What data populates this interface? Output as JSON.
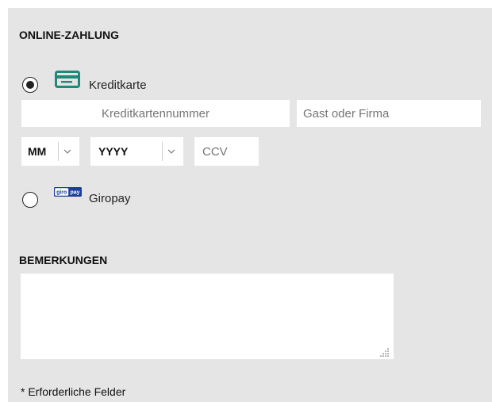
{
  "online_payment": {
    "title": "ONLINE-ZAHLUNG",
    "options": [
      {
        "label": "Kreditkarte",
        "selected": true,
        "icon": "credit-card-icon"
      },
      {
        "label": "Giropay",
        "selected": false,
        "icon": "giropay-logo"
      }
    ],
    "card_number_placeholder": "Kreditkartennummer",
    "name_placeholder": "Gast oder Firma",
    "month_select": "MM",
    "year_select": "YYYY",
    "ccv_placeholder": "CCV"
  },
  "remarks": {
    "title": "BEMERKUNGEN",
    "value": ""
  },
  "required_note": "* Erforderliche Felder",
  "colors": {
    "panel_bg": "#e5e5e5",
    "card_icon": "#1f8a7a",
    "giropay_blue": "#1c3f9c",
    "giropay_red": "#d2262b"
  }
}
